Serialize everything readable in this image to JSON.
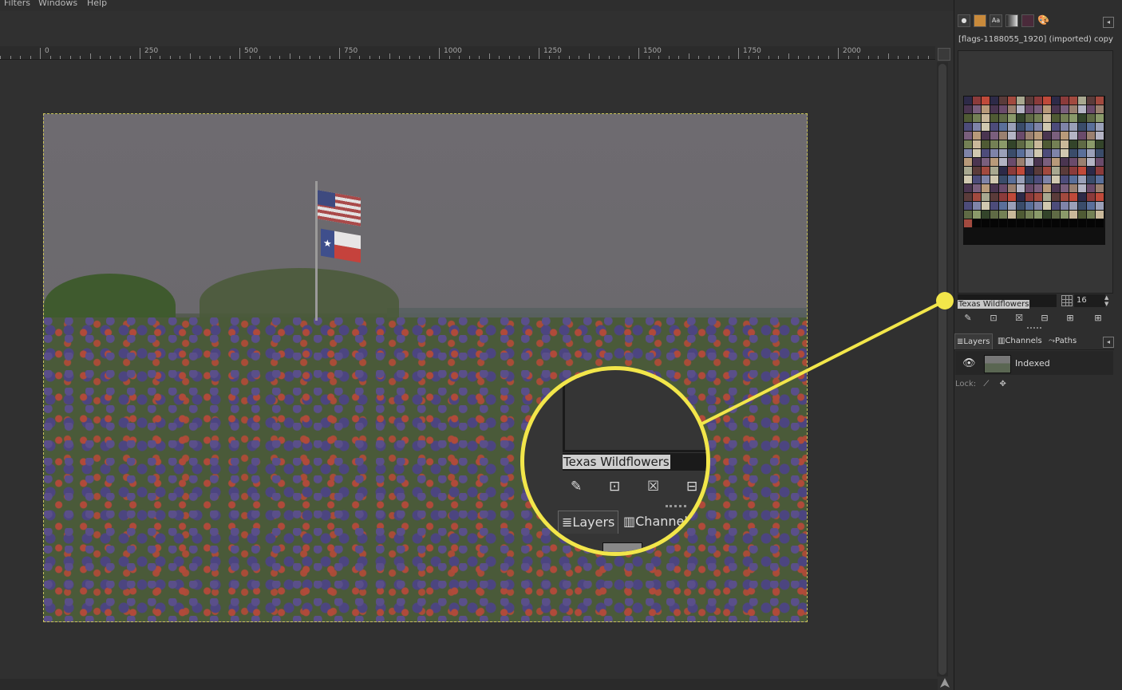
{
  "menu": [
    "Filters",
    "Windows",
    "Help"
  ],
  "ruler": {
    "labels": [
      "0",
      "250",
      "500",
      "750",
      "1000",
      "1250",
      "1500",
      "1750",
      "2000"
    ]
  },
  "canvas": {
    "image_description": "Texas flags over a field of bluebonnets and paintbrush wildflowers"
  },
  "right_panel": {
    "dock_icons": [
      "brush-icon",
      "pattern-icon",
      "font-icon",
      "gradient-icon",
      "palette-swatch-icon",
      "palette-icon"
    ],
    "title": "[flags-1188055_1920] (imported) copy",
    "palette_name": "Texas Wildflowers",
    "columns": "16",
    "layers_tabs": {
      "layers": "Layers",
      "channels": "Channels",
      "paths": "Paths"
    },
    "layer": {
      "name": "Indexed"
    },
    "lock_label": "Lock:"
  },
  "magnifier": {
    "palette_name": "Texas Wildflowers",
    "tabs": {
      "layers": "Layers",
      "channels": "Channel"
    }
  },
  "colors": {
    "callout": "#f2e64a",
    "background": "#303030",
    "panel": "#2e2e2e"
  }
}
